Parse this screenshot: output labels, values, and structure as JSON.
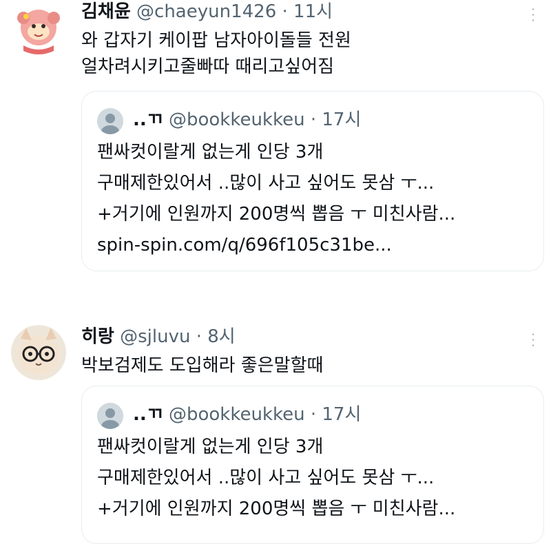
{
  "tweets": [
    {
      "name": "김채윤",
      "handle": "@chaeyun1426",
      "dot": "·",
      "time": "11시",
      "lines": [
        "와 갑자기 케이팝 남자아이돌들 전원",
        "얼차려시키고줄빠따 때리고싶어짐"
      ],
      "quote": {
        "name": "..ㄲ",
        "handle": "@bookkeukkeu",
        "dot": "·",
        "time": "17시",
        "lines": [
          "팬싸컷이랄게 없는게 인당 3개",
          "구매제한있어서 ..많이 사고 싶어도 못삼 ㅜ...",
          "+거기에 인원까지 200명씩 뽑음 ㅜ 미친사람...",
          "spin-spin.com/q/696f105c31be..."
        ]
      }
    },
    {
      "name": "히랑",
      "handle": "@sjluvu",
      "dot": "·",
      "time": "8시",
      "lines": [
        "박보검제도 도입해라 좋은말할때"
      ],
      "quote": {
        "name": "..ㄲ",
        "handle": "@bookkeukkeu",
        "dot": "·",
        "time": "17시",
        "lines": [
          "팬싸컷이랄게 없는게 인당 3개",
          "구매제한있어서 ..많이 사고 싶어도 못삼 ㅜ...",
          "+거기에 인원까지 200명씩 뽑음 ㅜ 미친사람..."
        ]
      }
    }
  ],
  "colors": {
    "text": "#0f1419",
    "muted": "#536471",
    "border": "#e6ecf0"
  },
  "icons": {
    "more": "more-options-icon",
    "avatar_placeholder": "default-avatar-icon"
  }
}
